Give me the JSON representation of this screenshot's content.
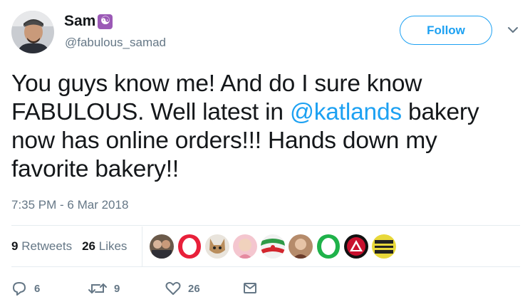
{
  "user": {
    "name": "Sam",
    "handle": "@fabulous_samad",
    "badge_glyph": "☯"
  },
  "follow": {
    "label": "Follow"
  },
  "tweet": {
    "text_before": "You guys know me! And do I sure know FABULOUS. Well latest in ",
    "mention": "@katlands",
    "text_after": " bakery now has online orders!!! Hands down my favorite bakery!!",
    "timestamp": "7:35 PM - 6 Mar 2018"
  },
  "stats": {
    "retweets_count": "9",
    "retweets_label": "Retweets",
    "likes_count": "26",
    "likes_label": "Likes"
  },
  "likers": [
    "photo",
    "opera-red",
    "cat-avatar",
    "pink-face",
    "flag",
    "woman",
    "opera-green",
    "red-triangle",
    "yellow-sign"
  ],
  "actions": {
    "reply_count": "6",
    "retweet_count": "9",
    "like_count": "26"
  },
  "colors": {
    "accent": "#1da1f2",
    "muted": "#657786",
    "text": "#14171a"
  }
}
